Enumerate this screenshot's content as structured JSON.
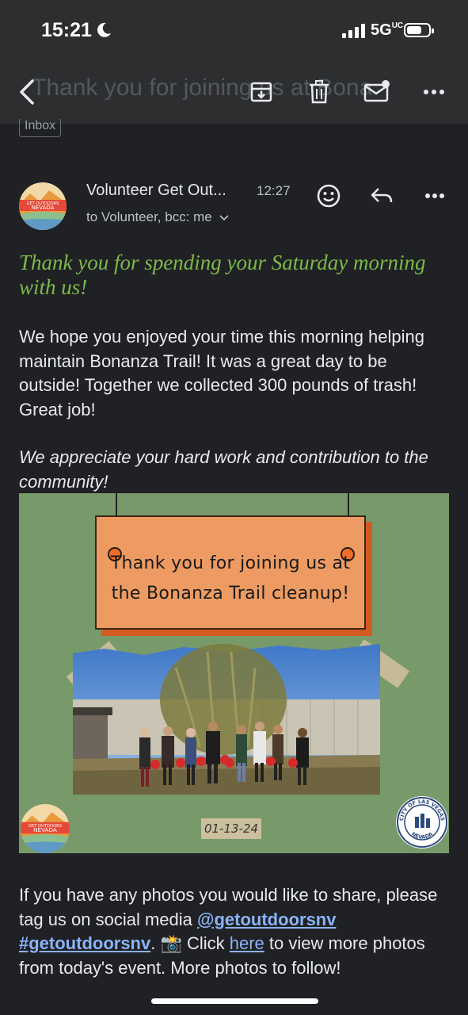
{
  "status_bar": {
    "time": "15:21",
    "network": "5G",
    "network_suffix": "UC"
  },
  "toolbar": {
    "title": "Thank you for joining us at Bonanza",
    "label_chip": "Inbox"
  },
  "email": {
    "sender": "Volunteer Get Out...",
    "time": "12:27",
    "recipients": "to Volunteer, bcc: me",
    "avatar_text": [
      "GET OUTDOORS",
      "NEVADA"
    ],
    "greeting": "Thank you for spending your Saturday morning with us!",
    "paragraph1": "We hope you enjoyed your time this morning helping maintain Bonanza Trail! It was a great day to be outside! Together we collected 300 pounds of trash! Great job!",
    "paragraph2": "We appreciate your hard work and contribution to the community!",
    "flyer": {
      "line1": "Thank you for joining us at",
      "line2": "the Bonanza Trail cleanup!",
      "date": "01-13-24",
      "logo_text": [
        "GET OUTDOORS",
        "NEVADA"
      ],
      "seal_top": "CITY OF LAS VEGAS",
      "seal_bottom": "NEVADA"
    },
    "footer": {
      "text1": "If you have any photos you would like to share, please tag us on social media ",
      "handle": "@getoutdoorsnv",
      "hashtag": "#getoutdoorsnv",
      "text2": ". 📸 Click ",
      "here_link": "here",
      "text3": " to view more photos from today's event. More photos to follow!"
    }
  },
  "colors": {
    "background": "#202124",
    "bar": "#2d2e30",
    "greeting": "#7dba4a",
    "link": "#8ab4f8",
    "flyer_bg": "#789a6b",
    "sign": "#ed9b62"
  }
}
